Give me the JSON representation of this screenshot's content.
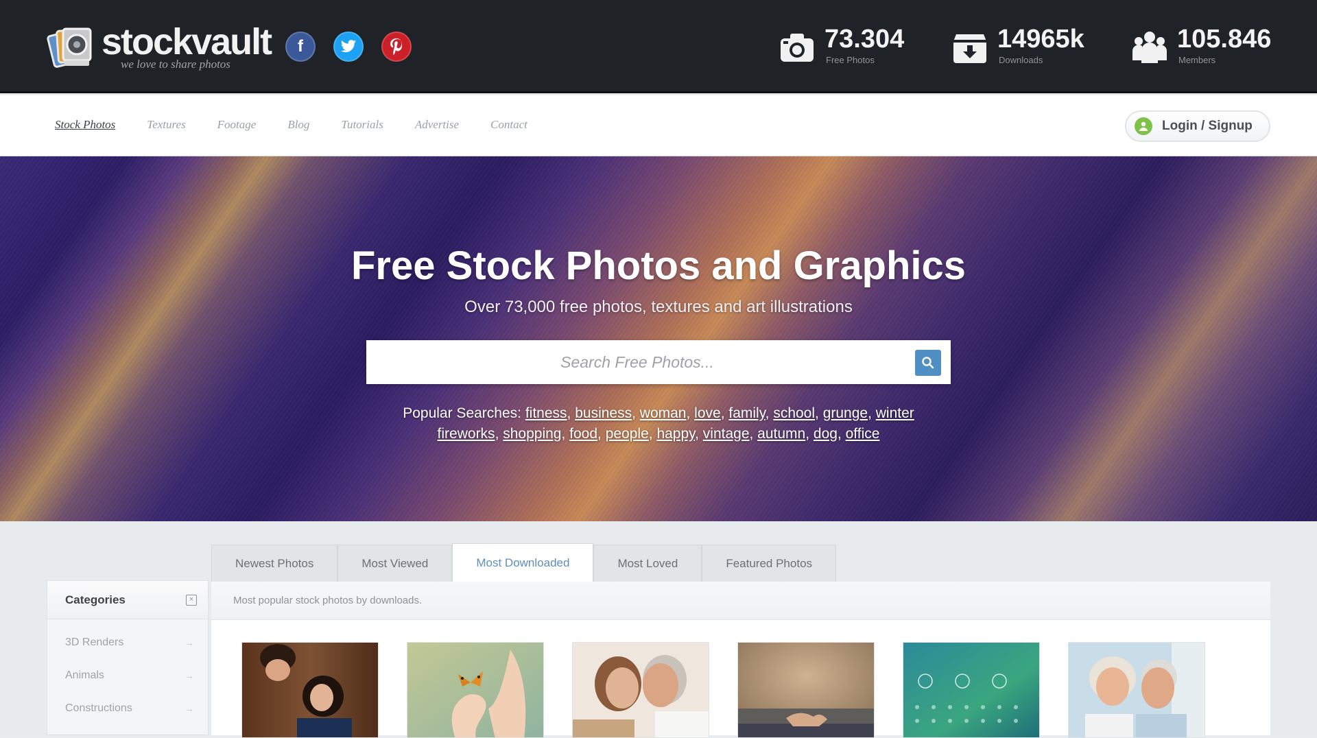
{
  "brand": {
    "name": "stockvault",
    "tagline": "we love to share photos",
    "colors": {
      "topbar": "#1f2328",
      "accent": "#5b8fc0",
      "login_dot": "#7ec24a"
    }
  },
  "social": [
    {
      "name": "facebook",
      "glyph": "f",
      "color": "#3b5998"
    },
    {
      "name": "twitter",
      "glyph": "t",
      "color": "#1da1f2"
    },
    {
      "name": "pinterest",
      "glyph": "p",
      "color": "#cb2027"
    }
  ],
  "stats": [
    {
      "icon": "camera-icon",
      "value": "73.304",
      "label": "Free Photos"
    },
    {
      "icon": "download-box-icon",
      "value": "14965k",
      "label": "Downloads"
    },
    {
      "icon": "members-icon",
      "value": "105.846",
      "label": "Members"
    }
  ],
  "nav": {
    "links": [
      "Stock Photos",
      "Textures",
      "Footage",
      "Blog",
      "Tutorials",
      "Advertise",
      "Contact"
    ],
    "active": "Stock Photos",
    "login_label": "Login / Signup"
  },
  "hero": {
    "title": "Free Stock Photos and Graphics",
    "subtitle": "Over 73,000 free photos, textures and art illustrations",
    "search_placeholder": "Search Free Photos...",
    "popular_label": "Popular Searches:",
    "popular_line1": [
      "fitness",
      "business",
      "woman",
      "love",
      "family",
      "school",
      "grunge",
      "winter"
    ],
    "popular_line2": [
      "fireworks",
      "shopping",
      "food",
      "people",
      "happy",
      "vintage",
      "autumn",
      "dog",
      "office"
    ]
  },
  "tabs": {
    "items": [
      "Newest Photos",
      "Most Viewed",
      "Most Downloaded",
      "Most Loved",
      "Featured Photos"
    ],
    "active": "Most Downloaded"
  },
  "panel": {
    "description": "Most popular stock photos by downloads."
  },
  "sidebar": {
    "title": "Categories",
    "items": [
      "3D Renders",
      "Animals",
      "Constructions"
    ]
  },
  "thumbnails": [
    {
      "name": "couple-lying-photo"
    },
    {
      "name": "butterfly-hand-photo"
    },
    {
      "name": "elderly-couple-embrace-photo"
    },
    {
      "name": "hands-belly-photo"
    },
    {
      "name": "calendar-app-photo"
    },
    {
      "name": "senior-couple-smiling-photo"
    }
  ]
}
